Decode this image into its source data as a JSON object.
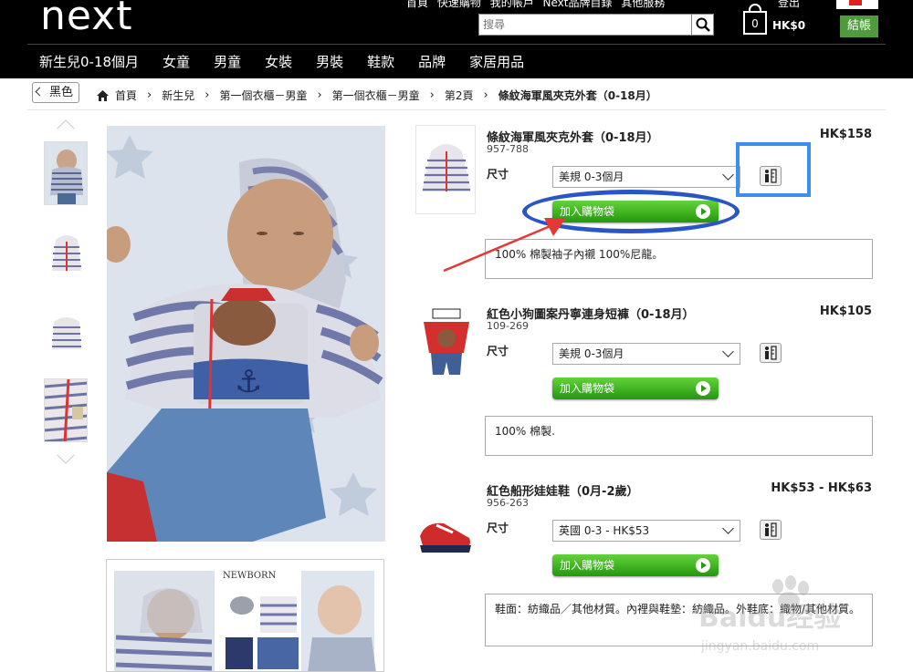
{
  "header": {
    "logo": "next",
    "top_links": [
      "首頁",
      "快速購物",
      "我的帳戶",
      "Next品牌目錄",
      "其他服務"
    ],
    "user_link": "登出",
    "search_placeholder": "搜尋",
    "bag_count": "0",
    "bag_total": "HK$0",
    "checkout_label": "結帳",
    "nav": [
      "新生兒0-18個月",
      "女童",
      "男童",
      "女裝",
      "男裝",
      "鞋款",
      "品牌",
      "家居用品"
    ]
  },
  "breadcrumb": {
    "back_label": "黑色",
    "items": [
      "首頁",
      "新生兒",
      "第一個衣櫃－男童",
      "第一個衣櫃－男童",
      "第2頁"
    ],
    "current": "條紋海軍風夾克外套（0-18月）"
  },
  "products": [
    {
      "title": "條紋海軍風夾克外套（0-18月）",
      "code": "957-788",
      "price": "HK$158",
      "size_label": "尺寸",
      "size_value": "美規 0-3個月",
      "add_label": "加入購物袋",
      "description": "100% 棉製袖子內襯 100%尼龍。"
    },
    {
      "title": "紅色小狗圖案丹寧連身短褲（0-18月）",
      "code": "109-269",
      "price": "HK$105",
      "size_label": "尺寸",
      "size_value": "美規 0-3個月",
      "add_label": "加入購物袋",
      "description": "100% 棉製."
    },
    {
      "title": "紅色船形娃娃鞋（0月-2歲）",
      "code": "956-263",
      "price": "HK$53 - HK$63",
      "size_label": "尺寸",
      "size_value": "英國 0-3 - HK$53",
      "add_label": "加入購物袋",
      "description": "鞋面：紡織品／其他材質。內裡與鞋墊：紡織品。外鞋底：織物/其他材質。"
    }
  ],
  "collage_text": "NEWBORN",
  "watermark": {
    "brand": "Baidu经验",
    "url": "jingyan.baidu.com"
  },
  "colors": {
    "header_bg": "#000000",
    "checkout": "#4e9a3c",
    "add_button": "#23980d",
    "annotation_blue": "#2a56c5",
    "annotation_arrow": "#e53935"
  }
}
